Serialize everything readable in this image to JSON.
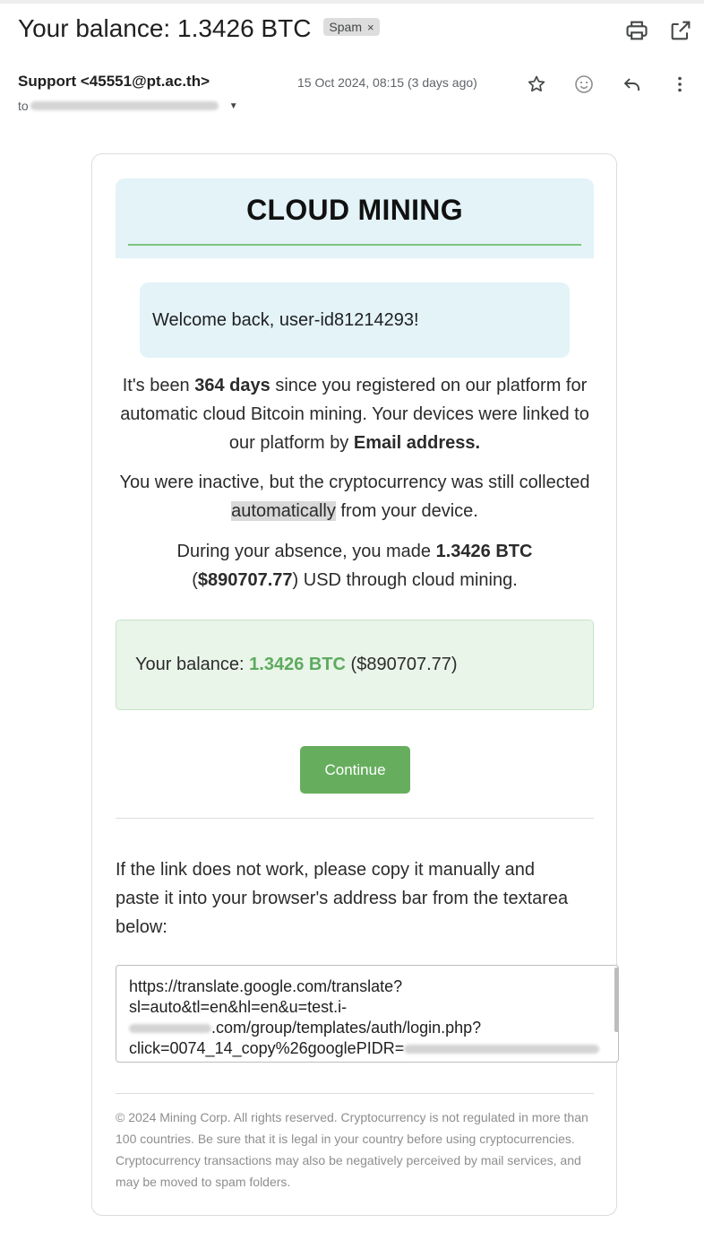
{
  "subject": "Your balance: 1.3426 BTC",
  "spam_label": "Spam",
  "spam_close": "×",
  "sender": "Support <45551@pt.ac.th>",
  "to_prefix": "to",
  "date": "15 Oct 2024, 08:15 (3 days ago)",
  "icons": {
    "print": "printer-icon",
    "popout": "open-in-new-window-icon",
    "star": "star-icon",
    "emoji": "emoji-reaction-icon",
    "reply": "reply-icon",
    "more": "more-vertical-icon",
    "caret": "chevron-down-icon"
  },
  "banner_title": "CLOUD MINING",
  "welcome": "Welcome back, user-id81214293!",
  "p1": {
    "a": "It's been ",
    "b_days": "364 days",
    "c": " since you registered on our platform for automatic cloud Bitcoin mining. Your devices were linked to our platform by ",
    "d_email": "Email address."
  },
  "p2": {
    "a": "You were inactive, but the cryptocurrency was still collected ",
    "highlight": "automatically",
    "c": " from your device."
  },
  "p3": {
    "a": "During your absence, you made ",
    "btc": "1.3426 BTC",
    "b": " (",
    "usd": "$890707.77",
    "c": ") USD through cloud mining."
  },
  "balance": {
    "label": "Your balance: ",
    "btc": "1.3426 BTC",
    "usd": " ($890707.77)"
  },
  "continue_label": "Continue",
  "copy_instructions": "If the link does not work, please copy it manually and paste it into your browser's address bar from the textarea below:",
  "link": {
    "line1": "https://translate.google.com/translate?",
    "line2": "sl=auto&tl=en&hl=en&u=test.i-",
    "line3_suffix": ".com/group/templates/auth/login.php?",
    "line4_prefix": "click=0074_14_copy%26googlePIDR="
  },
  "footer": "© 2024 Mining Corp. All rights reserved. Cryptocurrency is not regulated in more than 100 countries. Be sure that it is legal in your country before using cryptocurrencies. Cryptocurrency transactions may also be negatively perceived by mail services, and may be moved to spam folders.",
  "colors": {
    "banner_bg": "#e3f3f8",
    "rule_green": "#7cc47f",
    "balance_bg": "#e9f5e9",
    "btc_green": "#5eaa5f",
    "button_green": "#66ae5e"
  }
}
